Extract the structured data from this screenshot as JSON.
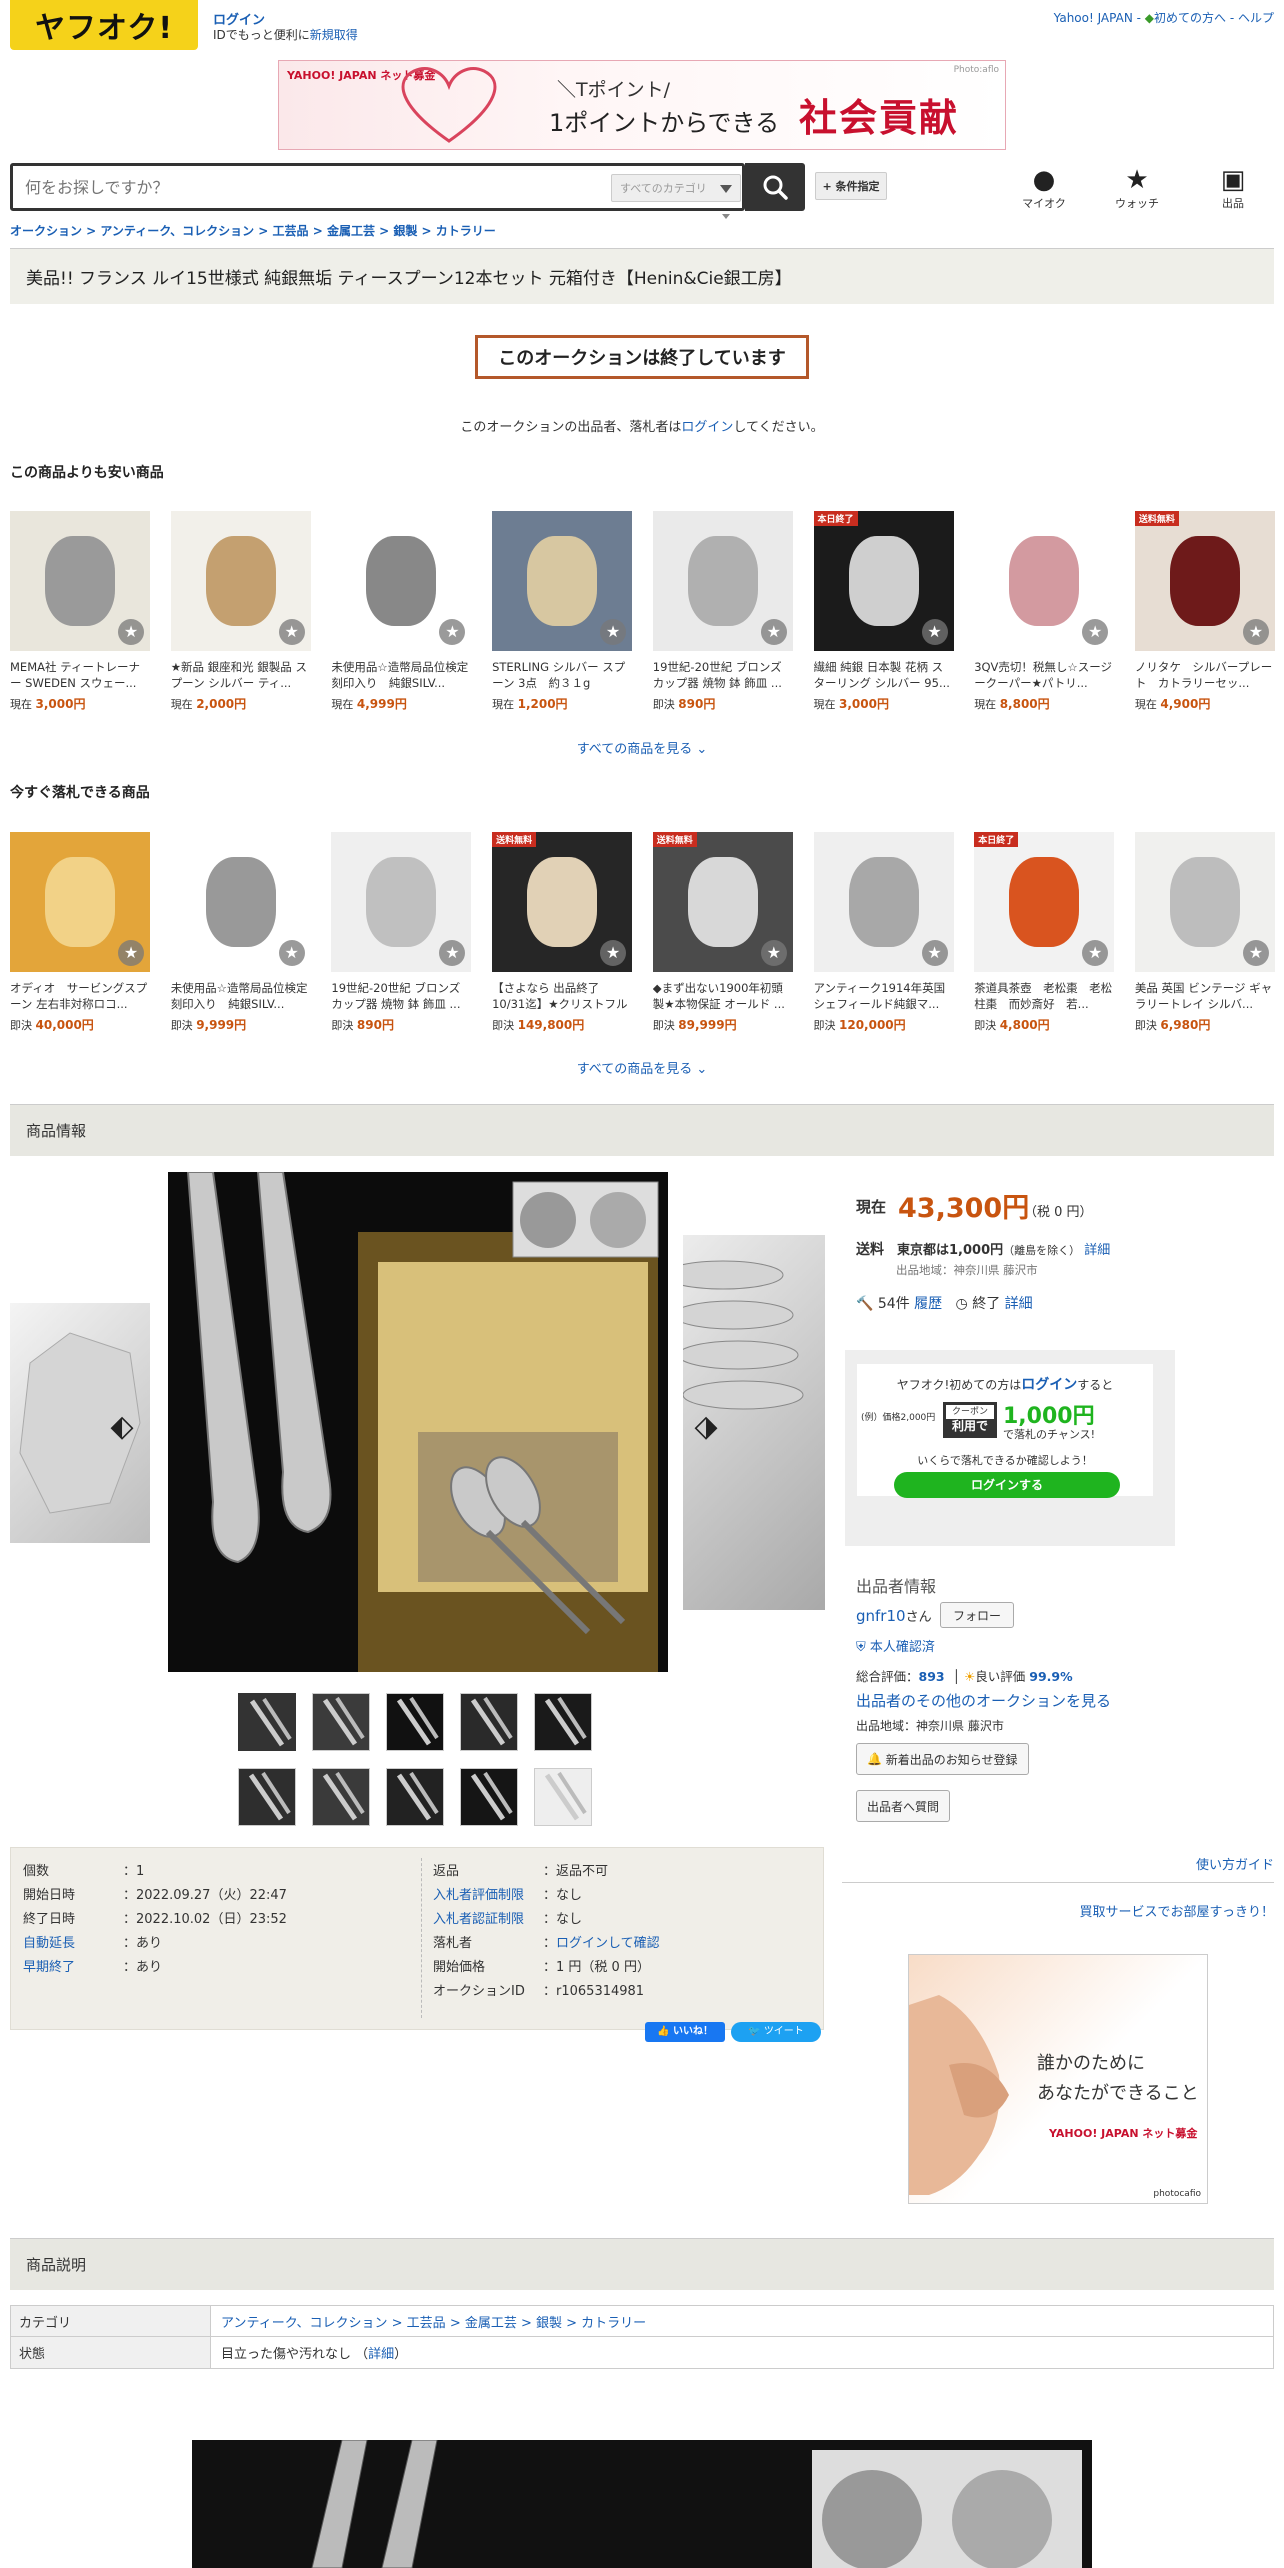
{
  "header": {
    "logo": "ヤフオク!",
    "login": "ログイン",
    "login_sub_prefix": "IDでもっと便利に",
    "register": "新規取得",
    "links": [
      "Yahoo! JAPAN",
      "初めての方へ",
      "ヘルプ"
    ]
  },
  "banner": {
    "brand": "YAHOO! JAPAN ネット募金",
    "line1": "＼Tポイント/",
    "line2": "1ポイントからできる",
    "line3": "社会貢献",
    "credit": "Photo:aflo"
  },
  "search": {
    "placeholder": "何をお探しですか？",
    "category": "すべてのカテゴリ",
    "condition_button": "+ 条件指定"
  },
  "header_icons": [
    {
      "name": "myauc",
      "label": "マイオク"
    },
    {
      "name": "watch",
      "label": "ウォッチ"
    },
    {
      "name": "sell",
      "label": "出品"
    }
  ],
  "breadcrumb": "オークション > アンティーク、コレクション > 工芸品 > 金属工芸 > 銀製 > カトラリー",
  "title": "美品!! フランス ルイ15世様式 純銀無垢 ティースプーン12本セット 元箱付き【Henin&Cie銀工房】",
  "ended": "このオークションは終了しています",
  "ended_note_pre": "このオークションの出品者、落札者は",
  "ended_note_link": "ログイン",
  "ended_note_post": "してください。",
  "cheaper": {
    "heading": "この商品よりも安い商品",
    "items": [
      {
        "name": "MEMA社 ティートレーナー SWEDEN スウェー...",
        "type": "現在",
        "price": "3,000円",
        "ribbon": ""
      },
      {
        "name": "★新品 銀座和光 銀製品 スプーン シルバー ティ...",
        "type": "現在",
        "price": "2,000円",
        "ribbon": ""
      },
      {
        "name": "未使用品☆造幣局品位検定刻印入り　純銀SILV...",
        "type": "現在",
        "price": "4,999円",
        "ribbon": ""
      },
      {
        "name": "STERLING シルバー スプーン 3点　約３１g",
        "type": "現在",
        "price": "1,200円",
        "ribbon": ""
      },
      {
        "name": "19世紀-20世紀 ブロンズ カップ器 焼物 鉢 飾皿 ...",
        "type": "即決",
        "price": "890円",
        "ribbon": ""
      },
      {
        "name": "繊細 純銀 日本製 花柄 スターリング シルバー 95...",
        "type": "現在",
        "price": "3,000円",
        "ribbon": "本日終了"
      },
      {
        "name": "3QV売切！税無し☆スージークーパー★パトリ...",
        "type": "現在",
        "price": "8,800円",
        "ribbon": ""
      },
      {
        "name": "ノリタケ　シルバープレート　カトラリーセッ...",
        "type": "現在",
        "price": "4,900円",
        "ribbon": "送料無料"
      }
    ],
    "see_all": "すべての商品を見る"
  },
  "ending_soon": {
    "heading": "今すぐ落札できる商品",
    "items": [
      {
        "name": "オディオ　サービングスプーン 左右非対称ロコ...",
        "type": "即決",
        "price": "40,000円",
        "ribbon": ""
      },
      {
        "name": "未使用品☆造幣局品位検定刻印入り　純銀SILV...",
        "type": "即決",
        "price": "9,999円",
        "ribbon": ""
      },
      {
        "name": "19世紀-20世紀 ブロンズ カップ器 焼物 鉢 飾皿 ...",
        "type": "即決",
        "price": "890円",
        "ribbon": ""
      },
      {
        "name": "【さよなら 出品終了10/31迄】★クリストフル ...",
        "type": "即決",
        "price": "149,800円",
        "ribbon": "送料無料"
      },
      {
        "name": "◆まず出ない1900年初頭製★本物保証 オールド ...",
        "type": "即決",
        "price": "89,999円",
        "ribbon": "送料無料"
      },
      {
        "name": "アンティーク1914年英国シェフィールド純銀マ...",
        "type": "即決",
        "price": "120,000円",
        "ribbon": ""
      },
      {
        "name": "茶道具茶壺　老松棗　老松柱棗　而妙斎好　若...",
        "type": "即決",
        "price": "4,800円",
        "ribbon": "本日終了"
      },
      {
        "name": "美品 英国 ビンテージ ギャラリートレイ シルバ...",
        "type": "即決",
        "price": "6,980円",
        "ribbon": ""
      }
    ],
    "see_all": "すべての商品を見る"
  },
  "product_info_heading": "商品情報",
  "info": {
    "left": [
      {
        "k": "個数",
        "v": "1",
        "link": false
      },
      {
        "k": "開始日時",
        "v": "2022.09.27（火）22:47",
        "link": false
      },
      {
        "k": "終了日時",
        "v": "2022.10.02（日）23:52",
        "link": false
      },
      {
        "k": "自動延長",
        "v": "あり",
        "link": true
      },
      {
        "k": "早期終了",
        "v": "あり",
        "link": true
      }
    ],
    "right": [
      {
        "k": "返品",
        "v": "返品不可",
        "link": false
      },
      {
        "k": "入札者評価制限",
        "v": "なし",
        "link": true
      },
      {
        "k": "入札者認証制限",
        "v": "なし",
        "link": true
      },
      {
        "k": "落札者",
        "v": "ログインして確認",
        "link": false,
        "vlink": true
      },
      {
        "k": "開始価格",
        "v": "1 円（税 0 円）",
        "link": false
      },
      {
        "k": "オークションID",
        "v": "r1065314981",
        "link": false
      }
    ]
  },
  "share": {
    "fb": "いいね！",
    "tw": "ツイート"
  },
  "price": {
    "label": "現在",
    "value": "43,300円",
    "tax": "（税 0 円）",
    "ship_label": "送料",
    "ship": "東京都は1,000円",
    "ship_note": "（離島を除く）",
    "ship_detail": "詳細",
    "ship_origin": "出品地域：神奈川県 藤沢市",
    "bids": "54件",
    "bids_link": "履歴",
    "end": "終了",
    "end_link": "詳細"
  },
  "promo": {
    "line1_pre": "ヤフオク!初めての方は",
    "line1_link": "ログイン",
    "line1_post": "すると",
    "example": "(例）価格2,000円",
    "coupon": "クーポン",
    "coupon_use": "利用で",
    "amount": "1,000円",
    "chance": "で落札のチャンス!",
    "check": "いくらで落札できるか確認しよう！",
    "button": "ログインする"
  },
  "seller": {
    "heading": "出品者情報",
    "name": "gnfr10",
    "san": "さん",
    "follow": "フォロー",
    "verified": "本人確認済",
    "rating_label": "総合評価：",
    "rating": "893",
    "good_label": "良い評価",
    "good": "99.9%",
    "other": "出品者のその他のオークションを見る",
    "location": "出品地域：神奈川県 藤沢市",
    "notify": "新着出品のお知らせ登録",
    "question": "出品者へ質問"
  },
  "guide": "使い方ガイド",
  "buy_service": "買取サービスでお部屋すっきり！",
  "ad2": {
    "line1": "誰かのために",
    "line2": "あなたができること",
    "brand": "YAHOO! JAPAN ネット募金",
    "credit": "photocafio"
  },
  "description_heading": "商品説明",
  "desc_rows": [
    {
      "k": "カテゴリ",
      "v": "アンティーク、コレクション > 工芸品 > 金属工芸 > 銀製 > カトラリー"
    },
    {
      "k": "状態",
      "v": "目立った傷や汚れなし",
      "detail": "詳細"
    }
  ],
  "colors": {
    "accent": "#c8540f",
    "link": "#1a5fb4",
    "logo_bg": "#f5d21a",
    "green": "#1fb41f"
  }
}
